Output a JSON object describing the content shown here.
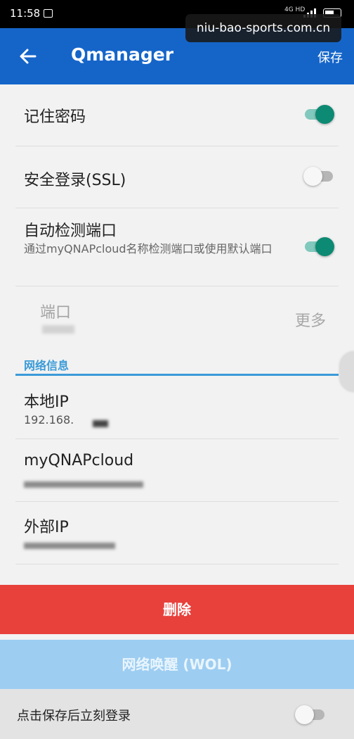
{
  "status_bar": {
    "time": "11:58",
    "network": "4G HD"
  },
  "watermark": "niu-bao-sports.com.cn",
  "app_bar": {
    "title": "Qmanager",
    "save_label": "保存"
  },
  "settings": {
    "remember_password": {
      "label": "记住密码",
      "enabled": true
    },
    "secure_login": {
      "label": "安全登录(SSL)",
      "enabled": false
    },
    "auto_detect_port": {
      "label": "自动检测端口",
      "description": "通过myQNAPcloud名称检测端口或使用默认端口",
      "enabled": true
    },
    "port": {
      "label": "端口",
      "more_label": "更多"
    }
  },
  "network_info": {
    "section_title": "网络信息",
    "local_ip": {
      "label": "本地IP",
      "value": "192.168."
    },
    "myqnapcloud": {
      "label": "myQNAPcloud"
    },
    "external_ip": {
      "label": "外部IP"
    }
  },
  "buttons": {
    "delete_label": "删除",
    "wol_label": "网络唤醒 (WOL)"
  },
  "login_after_save": {
    "label": "点击保存后立刻登录",
    "enabled": false
  },
  "colors": {
    "app_bar": "#1565c9",
    "toggle_on": "#0d8a73",
    "accent": "#3b9bd8",
    "delete": "#e8403b",
    "wol": "#9dcdf1"
  }
}
